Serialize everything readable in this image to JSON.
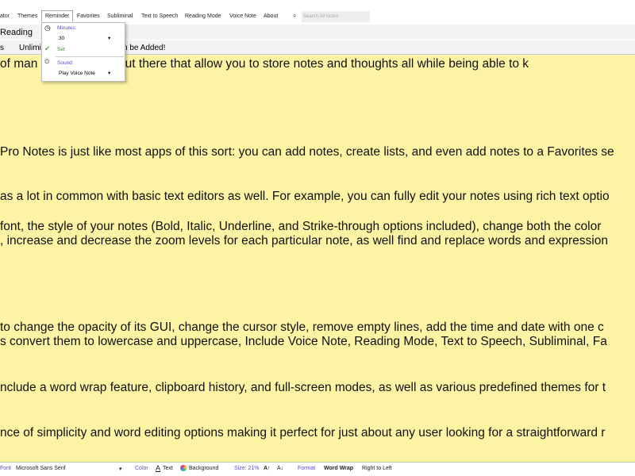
{
  "menu": {
    "items": [
      "ator",
      "Themes",
      "Reminder",
      "Favorites",
      "Subliminal",
      "Text to Speech",
      "Reading Mode",
      "Voice Note",
      "About"
    ],
    "search_placeholder": "Search All Notes"
  },
  "toolbar": {
    "reading": "Reading",
    "tab_s": "s",
    "banner": "Unlimi",
    "banner_tail": "n be Added!"
  },
  "reminder": {
    "minutes_label": "Minutes:",
    "minutes_value": "30",
    "set": "Set",
    "sound_label": "Sound:",
    "sound_value": "Play Voice Note"
  },
  "editor": {
    "lines": [
      "of man                    e-taking apps out there that allow you to store notes and thoughts all while being able to k",
      "Pro Notes is just like most apps of this sort: you can add notes, create lists, and even add notes to a Favorites se",
      "as a lot in common with basic text editors as well. For example, you can fully edit your notes using rich text optio",
      " font, the style of your notes (Bold, Italic, Underline, and Strike-through options included), change both the color",
      ", increase and decrease the zoom levels for each particular note, as well find and replace words and expression",
      " to change the opacity of its GUI, change the cursor style, remove empty lines, add the time and date with one c",
      "s convert them to lowercase and uppercase, Include Voice Note, Reading Mode, Text to Speech, Subliminal, Fa",
      "nclude a word wrap feature, clipboard history, and full-screen modes, as well as various predefined themes for t",
      "nce of simplicity and word editing options making it perfect for just about any user looking for a straightforward r"
    ]
  },
  "status": {
    "font_label": "Font",
    "font_value": "Microsoft Sans Serif",
    "color_label": "Color",
    "text": "Text",
    "background": "Background",
    "size": "Size: 21%",
    "grow": "A↑",
    "shrink": "A↓",
    "format": "Format",
    "word_wrap": "Word Wrap",
    "rtl": "Right to Left"
  }
}
